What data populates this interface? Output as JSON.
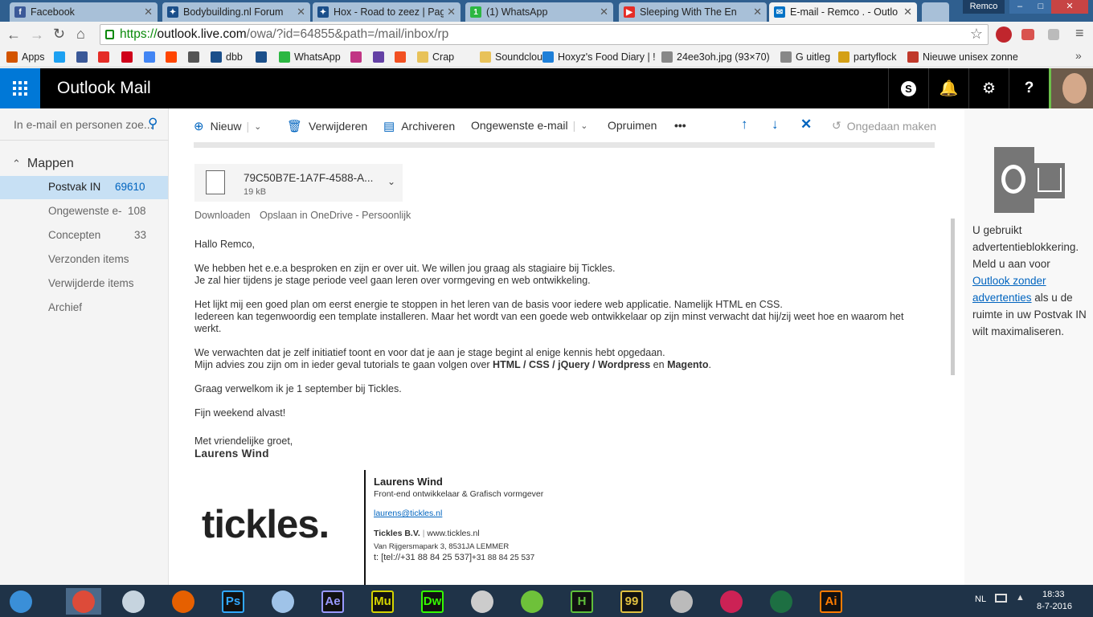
{
  "browser": {
    "tabs": [
      {
        "title": "Facebook",
        "favicon": "facebook-icon",
        "color": "#3b5998",
        "active": false
      },
      {
        "title": "Bodybuilding.nl Forum",
        "favicon": "forum-icon",
        "color": "#1b4f8a",
        "active": false
      },
      {
        "title": "Hox - Road to zeez | Pag",
        "favicon": "forum-icon",
        "color": "#1b4f8a",
        "active": false
      },
      {
        "title": "(1) WhatsApp",
        "favicon": "whatsapp-icon",
        "color": "#2cb742",
        "active": false
      },
      {
        "title": "Sleeping With The En",
        "favicon": "youtube-icon",
        "color": "#e52d27",
        "active": false
      },
      {
        "title": "E-mail - Remco . - Outlo",
        "favicon": "mail-icon",
        "color": "#0072c6",
        "active": true
      }
    ],
    "close_glyph": "✕",
    "window_user": "Remco",
    "url": {
      "scheme": "https://",
      "host": "outlook.live.com",
      "path": "/owa/?id=64855&path=/mail/inbox/rp"
    },
    "bookmarks": [
      {
        "label": "Apps",
        "icon": "apps-grid-icon",
        "color": "#d35400"
      },
      {
        "label": "",
        "icon": "twitter-icon",
        "color": "#1da1f2"
      },
      {
        "label": "",
        "icon": "facebook-icon",
        "color": "#3b5998"
      },
      {
        "label": "",
        "icon": "youtube-icon",
        "color": "#e52d27"
      },
      {
        "label": "",
        "icon": "dumpert-icon",
        "color": "#d0021b"
      },
      {
        "label": "",
        "icon": "google-icon",
        "color": "#4285f4"
      },
      {
        "label": "",
        "icon": "reddit-icon",
        "color": "#ff4500"
      },
      {
        "label": "",
        "icon": "bookmark-icon",
        "color": "#555555"
      },
      {
        "label": "dbb",
        "icon": "forum-icon",
        "color": "#1b4f8a"
      },
      {
        "label": "",
        "icon": "forum-icon",
        "color": "#1b4f8a"
      },
      {
        "label": "WhatsApp",
        "icon": "whatsapp-icon",
        "color": "#2cb742"
      },
      {
        "label": "",
        "icon": "instagram-icon",
        "color": "#c13584"
      },
      {
        "label": "",
        "icon": "twitch-icon",
        "color": "#6441a5"
      },
      {
        "label": "",
        "icon": "windows-icon",
        "color": "#f25022"
      },
      {
        "label": "Crap",
        "icon": "folder-icon",
        "color": "#e8c25a"
      },
      {
        "label": "Soundcloud",
        "icon": "folder-icon",
        "color": "#e8c25a"
      },
      {
        "label": "Hoxyz's Food Diary | !",
        "icon": "food-diary-icon",
        "color": "#1e7fd8"
      },
      {
        "label": "24ee3oh.jpg (93×70)",
        "icon": "image-icon",
        "color": "#888888"
      },
      {
        "label": "G uitleg",
        "icon": "page-icon",
        "color": "#888888"
      },
      {
        "label": "partyflock",
        "icon": "partyflock-icon",
        "color": "#d4a017"
      },
      {
        "label": "Nieuwe unisex zonne",
        "icon": "shop-icon",
        "color": "#c0392b"
      }
    ]
  },
  "outlook": {
    "title": "Outlook Mail",
    "search_placeholder": "In e-mail en personen zoe...",
    "folders_header": "Mappen",
    "folders": [
      {
        "label": "Postvak IN",
        "count": "69610",
        "selected": true
      },
      {
        "label": "Ongewenste e-",
        "count": "108",
        "selected": false
      },
      {
        "label": "Concepten",
        "count": "33",
        "selected": false
      },
      {
        "label": "Verzonden items",
        "count": "",
        "selected": false
      },
      {
        "label": "Verwijderde items",
        "count": "",
        "selected": false
      },
      {
        "label": "Archief",
        "count": "",
        "selected": false
      }
    ],
    "commands": {
      "new": "Nieuw",
      "delete": "Verwijderen",
      "archive": "Archiveren",
      "junk": "Ongewenste e-mail",
      "sweep": "Opruimen",
      "more": "•••",
      "undo": "Ongedaan maken"
    },
    "attachment": {
      "name": "79C50B7E-1A7F-4588-A...",
      "size": "19 kB",
      "download": "Downloaden",
      "save_onedrive": "Opslaan in OneDrive - Persoonlijk"
    },
    "email": {
      "greeting": "Hallo Remco,",
      "p1": [
        "We hebben het e.e.a besproken en zijn er over uit. We willen jou graag als stagiaire bij Tickles.",
        "Je zal hier tijdens je stage periode veel gaan leren over vormgeving en web ontwikkeling."
      ],
      "p2": [
        "Het lijkt mij een goed plan om eerst energie te stoppen in het leren van de basis voor iedere web applicatie. Namelijk HTML en CSS.",
        "Iedereen kan tegenwoordig een template installeren. Maar het wordt van een goede web ontwikkelaar op zijn minst verwacht dat hij/zij weet hoe en waarom het",
        "werkt."
      ],
      "p3": "We verwachten dat je zelf initiatief toont en voor dat je aan je stage begint al enige kennis hebt opgedaan.",
      "p4_prefix": "Mijn advies zou zijn om in ieder geval tutorials te gaan volgen over ",
      "tech": [
        "HTML",
        "CSS",
        "jQuery",
        "Wordpress",
        "Magento"
      ],
      "sep": " / ",
      "and_word": " en ",
      "period": ".",
      "p5": "Graag verwelkom ik je 1 september bij Tickles.",
      "p6": "Fijn weekend alvast!",
      "closing": "Met vriendelijke groet,",
      "sender": "Laurens Wind"
    },
    "signature": {
      "logo": "tickles.",
      "name": "Laurens Wind",
      "role": "Front-end ontwikkelaar & Grafisch vormgever",
      "email": "laurens@tickles.nl",
      "company": "Tickles B.V.",
      "company_sep": " | ",
      "website": "www.tickles.nl",
      "address": "Van Rijgersmapark 3, 8531JA LEMMER",
      "phone": "t: [tel://+31 88 84 25 537]",
      "phone2": "+31 88 84 25 537"
    },
    "adblock": {
      "text1": "U gebruikt advertentieblokkering. Meld u aan voor ",
      "link": "Outlook zonder advertenties",
      "text2": " als u de ruimte in uw Postvak IN wilt maximaliseren."
    }
  },
  "taskbar": {
    "apps": [
      {
        "label": "",
        "icon": "windows-start-icon",
        "color": "#3a8fd8"
      },
      {
        "label": "",
        "icon": "chrome-icon",
        "color": "#dd4b39"
      },
      {
        "label": "",
        "icon": "steam-icon",
        "color": "#c6d4df"
      },
      {
        "label": "",
        "icon": "firefox-icon",
        "color": "#e66000"
      },
      {
        "label": "Ps",
        "icon": "photoshop-icon",
        "color": "#31a8ff"
      },
      {
        "label": "",
        "icon": "keyboard-icon",
        "color": "#9fc3e8"
      },
      {
        "label": "Ae",
        "icon": "after-effects-icon",
        "color": "#9999ff"
      },
      {
        "label": "Mu",
        "icon": "muse-icon",
        "color": "#d4d400"
      },
      {
        "label": "Dw",
        "icon": "dreamweaver-icon",
        "color": "#35fa00"
      },
      {
        "label": "",
        "icon": "film-icon",
        "color": "#cccccc"
      },
      {
        "label": "",
        "icon": "app-icon",
        "color": "#6ec13a"
      },
      {
        "label": "H",
        "icon": "hamachi-icon",
        "color": "#5fbf3a"
      },
      {
        "label": "99",
        "icon": "tool-icon",
        "color": "#e0c040"
      },
      {
        "label": "",
        "icon": "media-icon",
        "color": "#bbbbbb"
      },
      {
        "label": "",
        "icon": "game-icon",
        "color": "#cc2255"
      },
      {
        "label": "",
        "icon": "excel-icon",
        "color": "#1d6f42"
      },
      {
        "label": "Ai",
        "icon": "illustrator-icon",
        "color": "#ff7c00"
      }
    ],
    "lang": "NL",
    "time": "18:33",
    "date": "8-7-2016"
  }
}
